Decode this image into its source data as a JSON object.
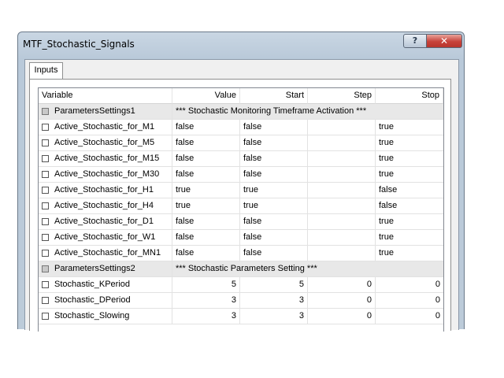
{
  "window": {
    "title": "MTF_Stochastic_Signals",
    "help_glyph": "?",
    "close_glyph": "✕"
  },
  "tabs": [
    {
      "label": "Inputs"
    }
  ],
  "grid": {
    "columns": [
      "Variable",
      "Value",
      "Start",
      "Step",
      "Stop"
    ],
    "rows": [
      {
        "group": true,
        "name": "ParametersSettings1",
        "label": "*** Stochastic Monitoring Timeframe Activation ***"
      },
      {
        "group": false,
        "name": "Active_Stochastic_for_M1",
        "value": "false",
        "start": "false",
        "step": "",
        "stop": "true"
      },
      {
        "group": false,
        "name": "Active_Stochastic_for_M5",
        "value": "false",
        "start": "false",
        "step": "",
        "stop": "true"
      },
      {
        "group": false,
        "name": "Active_Stochastic_for_M15",
        "value": "false",
        "start": "false",
        "step": "",
        "stop": "true"
      },
      {
        "group": false,
        "name": "Active_Stochastic_for_M30",
        "value": "false",
        "start": "false",
        "step": "",
        "stop": "true"
      },
      {
        "group": false,
        "name": "Active_Stochastic_for_H1",
        "value": "true",
        "start": "true",
        "step": "",
        "stop": "false"
      },
      {
        "group": false,
        "name": "Active_Stochastic_for_H4",
        "value": "true",
        "start": "true",
        "step": "",
        "stop": "false"
      },
      {
        "group": false,
        "name": "Active_Stochastic_for_D1",
        "value": "false",
        "start": "false",
        "step": "",
        "stop": "true"
      },
      {
        "group": false,
        "name": "Active_Stochastic_for_W1",
        "value": "false",
        "start": "false",
        "step": "",
        "stop": "true"
      },
      {
        "group": false,
        "name": "Active_Stochastic_for_MN1",
        "value": "false",
        "start": "false",
        "step": "",
        "stop": "true"
      },
      {
        "group": true,
        "name": "ParametersSettings2",
        "label": "*** Stochastic Parameters Setting ***"
      },
      {
        "group": false,
        "numeric": true,
        "name": "Stochastic_KPeriod",
        "value": "5",
        "start": "5",
        "step": "0",
        "stop": "0"
      },
      {
        "group": false,
        "numeric": true,
        "name": "Stochastic_DPeriod",
        "value": "3",
        "start": "3",
        "step": "0",
        "stop": "0"
      },
      {
        "group": false,
        "numeric": true,
        "name": "Stochastic_Slowing",
        "value": "3",
        "start": "3",
        "step": "0",
        "stop": "0"
      }
    ]
  }
}
